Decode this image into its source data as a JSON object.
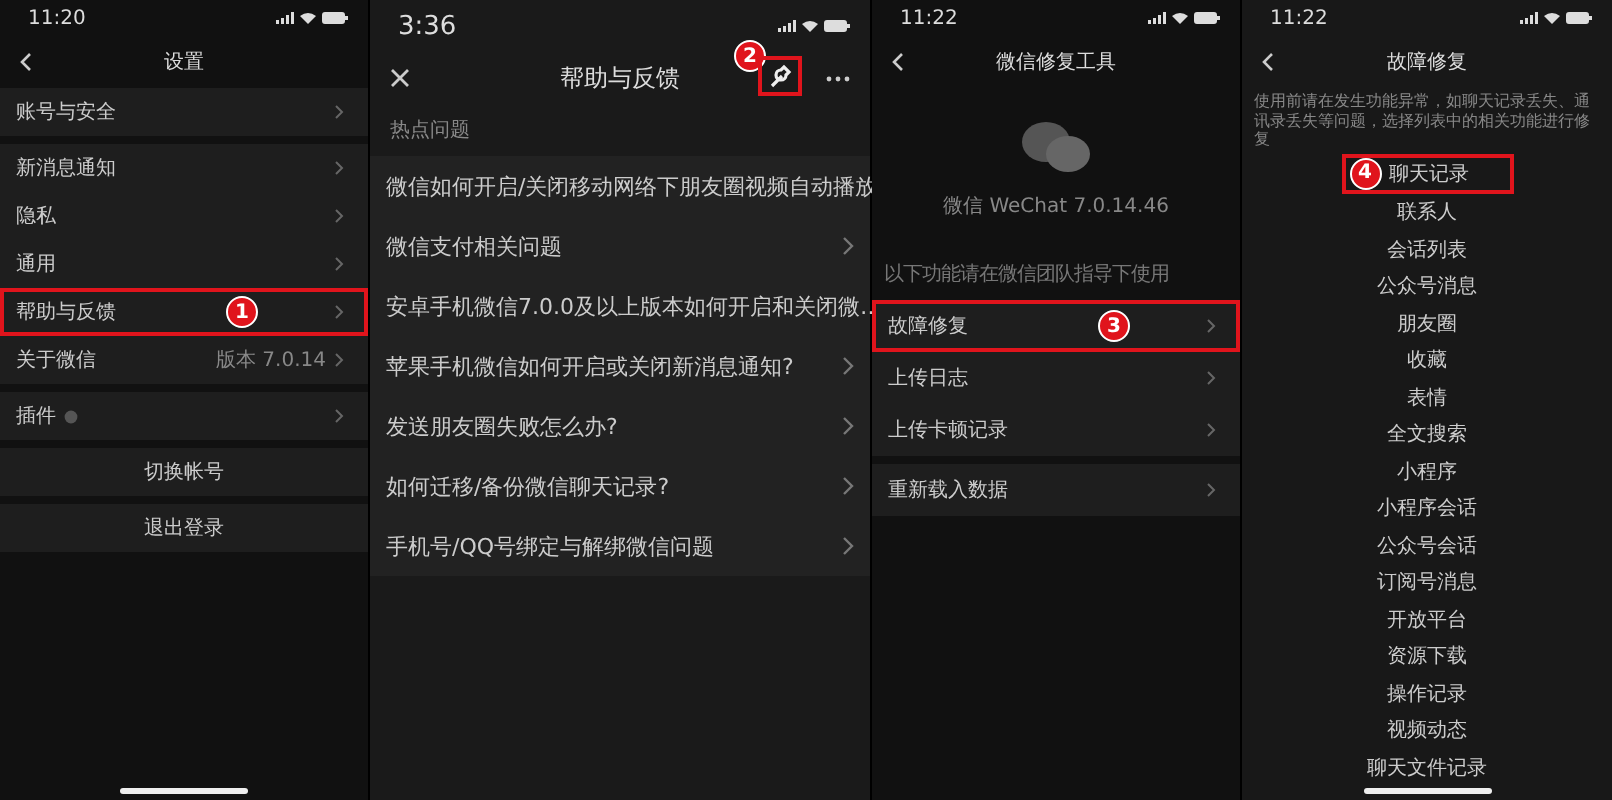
{
  "screens": [
    {
      "kind": "settings",
      "time": "11:20",
      "title": "设置",
      "home_indicator": true,
      "groups": [
        {
          "items": [
            {
              "label": "账号与安全",
              "highlighted": false
            }
          ]
        },
        {
          "items": [
            {
              "label": "新消息通知",
              "highlighted": false
            },
            {
              "label": "隐私",
              "highlighted": false
            },
            {
              "label": "通用",
              "highlighted": false
            },
            {
              "label": "帮助与反馈",
              "highlighted": true,
              "step": "1"
            },
            {
              "label": "关于微信",
              "value": "版本 7.0.14",
              "highlighted": false
            }
          ]
        },
        {
          "items": [
            {
              "label": "插件",
              "info": true,
              "highlighted": false
            }
          ]
        }
      ],
      "actions": [
        "切换帐号",
        "退出登录"
      ]
    },
    {
      "kind": "help",
      "time": "3:36",
      "title": "帮助与反馈",
      "home_indicator": false,
      "tool_button": {
        "highlighted": true,
        "step": "2"
      },
      "section": "热点问题",
      "items": [
        {
          "label": "微信如何开启/关闭移动网络下朋友圈视频自动播放"
        },
        {
          "label": "微信支付相关问题"
        },
        {
          "label": "安卓手机微信7.0.0及以上版本如何开启和关闭微…"
        },
        {
          "label": "苹果手机微信如何开启或关闭新消息通知?"
        },
        {
          "label": "发送朋友圈失败怎么办?"
        },
        {
          "label": "如何迁移/备份微信聊天记录?"
        },
        {
          "label": "手机号/QQ号绑定与解绑微信问题"
        }
      ]
    },
    {
      "kind": "tool",
      "time": "11:22",
      "title": "微信修复工具",
      "home_indicator": false,
      "version": "微信 WeChat 7.0.14.46",
      "subtitle": "以下功能请在微信团队指导下使用",
      "groups": [
        {
          "items": [
            {
              "label": "故障修复",
              "highlighted": true,
              "step": "3"
            },
            {
              "label": "上传日志",
              "highlighted": false
            },
            {
              "label": "上传卡顿记录",
              "highlighted": false
            }
          ]
        },
        {
          "items": [
            {
              "label": "重新载入数据",
              "highlighted": false
            }
          ]
        }
      ]
    },
    {
      "kind": "repair",
      "time": "11:22",
      "title": "故障修复",
      "home_indicator": true,
      "description": "使用前请在发生功能异常，如聊天记录丢失、通讯录丢失等问题，选择列表中的相关功能进行修复",
      "items": [
        {
          "label": "聊天记录",
          "highlighted": true,
          "step": "4"
        },
        {
          "label": "联系人",
          "highlighted": false
        },
        {
          "label": "会话列表",
          "highlighted": false
        },
        {
          "label": "公众号消息",
          "highlighted": false
        },
        {
          "label": "朋友圈",
          "highlighted": false
        },
        {
          "label": "收藏",
          "highlighted": false
        },
        {
          "label": "表情",
          "highlighted": false
        },
        {
          "label": "全文搜索",
          "highlighted": false
        },
        {
          "label": "小程序",
          "highlighted": false
        },
        {
          "label": "小程序会话",
          "highlighted": false
        },
        {
          "label": "公众号会话",
          "highlighted": false
        },
        {
          "label": "订阅号消息",
          "highlighted": false
        },
        {
          "label": "开放平台",
          "highlighted": false
        },
        {
          "label": "资源下载",
          "highlighted": false
        },
        {
          "label": "操作记录",
          "highlighted": false
        },
        {
          "label": "视频动态",
          "highlighted": false
        },
        {
          "label": "聊天文件记录",
          "highlighted": false
        }
      ]
    }
  ]
}
